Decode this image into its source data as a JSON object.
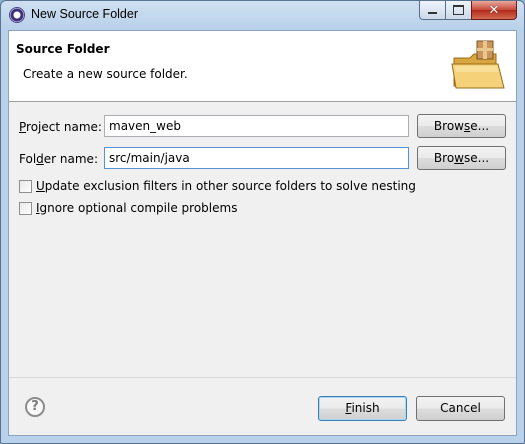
{
  "window": {
    "title": "New Source Folder"
  },
  "banner": {
    "title": "Source Folder",
    "description": "Create a new source folder."
  },
  "project": {
    "label_pre": "",
    "label_mnemonic": "P",
    "label_post": "roject name:",
    "value": "maven_web",
    "browse_pre": "Brow",
    "browse_mnemonic": "s",
    "browse_post": "e..."
  },
  "folder": {
    "label_pre": "Fol",
    "label_mnemonic": "d",
    "label_post": "er name:",
    "value": "src/main/java",
    "browse_pre": "Bro",
    "browse_mnemonic": "w",
    "browse_post": "se..."
  },
  "options": {
    "update_pre": "",
    "update_mnemonic": "U",
    "update_post": "pdate exclusion filters in other source folders to solve nesting",
    "update_checked": false,
    "ignore_pre": "",
    "ignore_mnemonic": "I",
    "ignore_post": "gnore optional compile problems",
    "ignore_checked": false
  },
  "footer": {
    "finish_pre": "",
    "finish_mnemonic": "F",
    "finish_post": "inish",
    "cancel_label": "Cancel",
    "help_glyph": "?"
  },
  "icons": {
    "app": "eclipse-icon",
    "banner": "folder-with-package-icon",
    "help": "help-icon"
  }
}
